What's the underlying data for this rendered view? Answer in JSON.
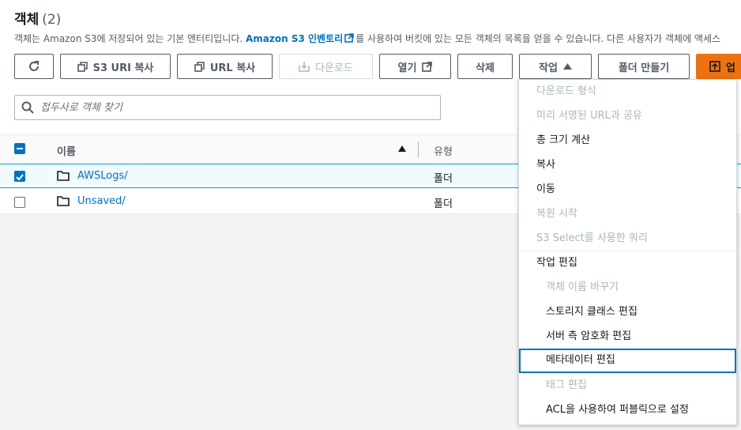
{
  "header": {
    "title": "객체",
    "count": "(2)",
    "desc_before": "객체는 Amazon S3에 저장되어 있는 기본 엔터티입니다. ",
    "desc_link": "Amazon S3 인벤토리",
    "desc_after": "를 사용하여 버킷에 있는 모든 객체의 목록을 얻을 수 있습니다. 다른 사용자가 객체에 액세스"
  },
  "toolbar": {
    "refresh_label": "",
    "copy_s3_uri": "S3 URI 복사",
    "copy_url": "URL 복사",
    "download": "다운로드",
    "open": "열기",
    "delete": "삭제",
    "actions": "작업",
    "create_folder": "폴더 만들기",
    "upload": "업"
  },
  "search": {
    "placeholder": "접두사로 객체 찾기"
  },
  "table": {
    "columns": [
      "이름",
      "유형"
    ],
    "rows": [
      {
        "name": "AWSLogs/",
        "type": "폴더",
        "selected": true
      },
      {
        "name": "Unsaved/",
        "type": "폴더",
        "selected": false
      }
    ]
  },
  "actions_menu": {
    "items": [
      {
        "label": "다운로드 형식",
        "disabled": true
      },
      {
        "label": "미리 서명된 URL과 공유",
        "disabled": true
      },
      {
        "label": "총 크기 계산",
        "disabled": false
      },
      {
        "label": "복사",
        "disabled": false
      },
      {
        "label": "이동",
        "disabled": false
      },
      {
        "label": "복원 시작",
        "disabled": true
      },
      {
        "label": "S3 Select를 사용한 쿼리",
        "disabled": true
      }
    ],
    "group_label": "작업 편집",
    "sub_items": [
      {
        "label": "객체 이름 바꾸기",
        "disabled": true
      },
      {
        "label": "스토리지 클래스 편집",
        "disabled": false
      },
      {
        "label": "서버 측 암호화 편집",
        "disabled": false
      },
      {
        "label": "메타데이터 편집",
        "disabled": false,
        "focused": true
      },
      {
        "label": "태그 편집",
        "disabled": true
      },
      {
        "label": "ACL을 사용하여 퍼블릭으로 설정",
        "disabled": false
      }
    ]
  },
  "colors": {
    "link": "#0073bb",
    "primary": "#ec7211",
    "selected_row": "#f1faff",
    "disabled_text": "#aab7b8"
  },
  "icons": [
    "refresh-icon",
    "copy-icon",
    "download-icon",
    "external-link-icon",
    "caret-up-icon",
    "upload-icon",
    "search-icon",
    "folder-icon"
  ]
}
